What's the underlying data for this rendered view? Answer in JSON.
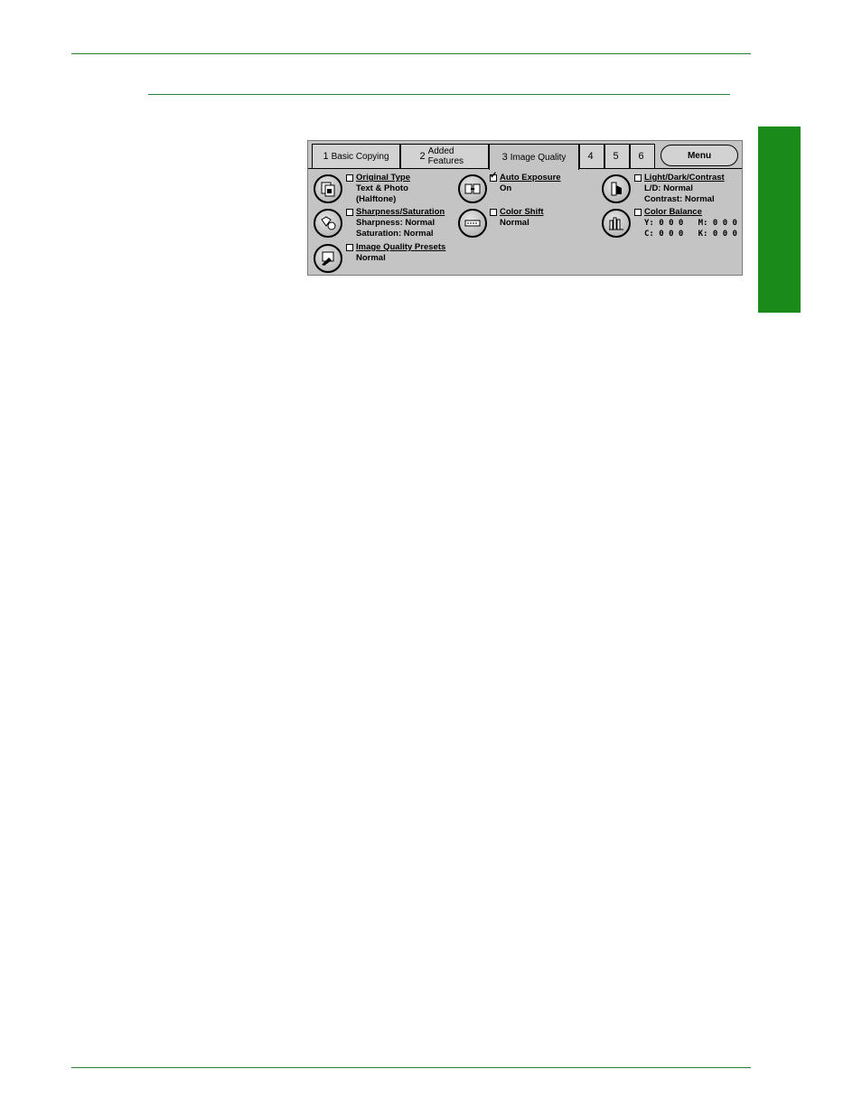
{
  "tabs": [
    {
      "num": "1",
      "label": "Basic Copying"
    },
    {
      "num": "2",
      "label": "Added Features"
    },
    {
      "num": "3",
      "label": "Image Quality"
    },
    {
      "num": "4",
      "label": ""
    },
    {
      "num": "5",
      "label": ""
    },
    {
      "num": "6",
      "label": ""
    }
  ],
  "menu_label": "Menu",
  "features": {
    "original_type": {
      "title": "Original Type",
      "line1": "Text & Photo",
      "line2": "(Halftone)",
      "checked": false
    },
    "sharpness": {
      "title": "Sharpness/Saturation",
      "line1": "Sharpness: Normal",
      "line2": "Saturation: Normal",
      "checked": false
    },
    "presets": {
      "title": "Image Quality Presets",
      "line1": "Normal",
      "checked": false
    },
    "auto_exposure": {
      "title": "Auto Exposure",
      "line1": "On",
      "checked": true
    },
    "color_shift": {
      "title": "Color Shift",
      "line1": "Normal",
      "checked": false
    },
    "light_dark": {
      "title": "Light/Dark/Contrast",
      "line1": "L/D: Normal",
      "line2": "Contrast: Normal",
      "checked": false
    },
    "color_balance": {
      "title": "Color Balance",
      "line1": "Y: 0 0 0   M: 0 0 0",
      "line2": "C: 0 0 0   K: 0 0 0",
      "checked": false
    }
  },
  "colors": {
    "accent_green": "#1a8a1a",
    "rule_green": "#2e7d32",
    "panel_gray": "#c4c4c4"
  }
}
